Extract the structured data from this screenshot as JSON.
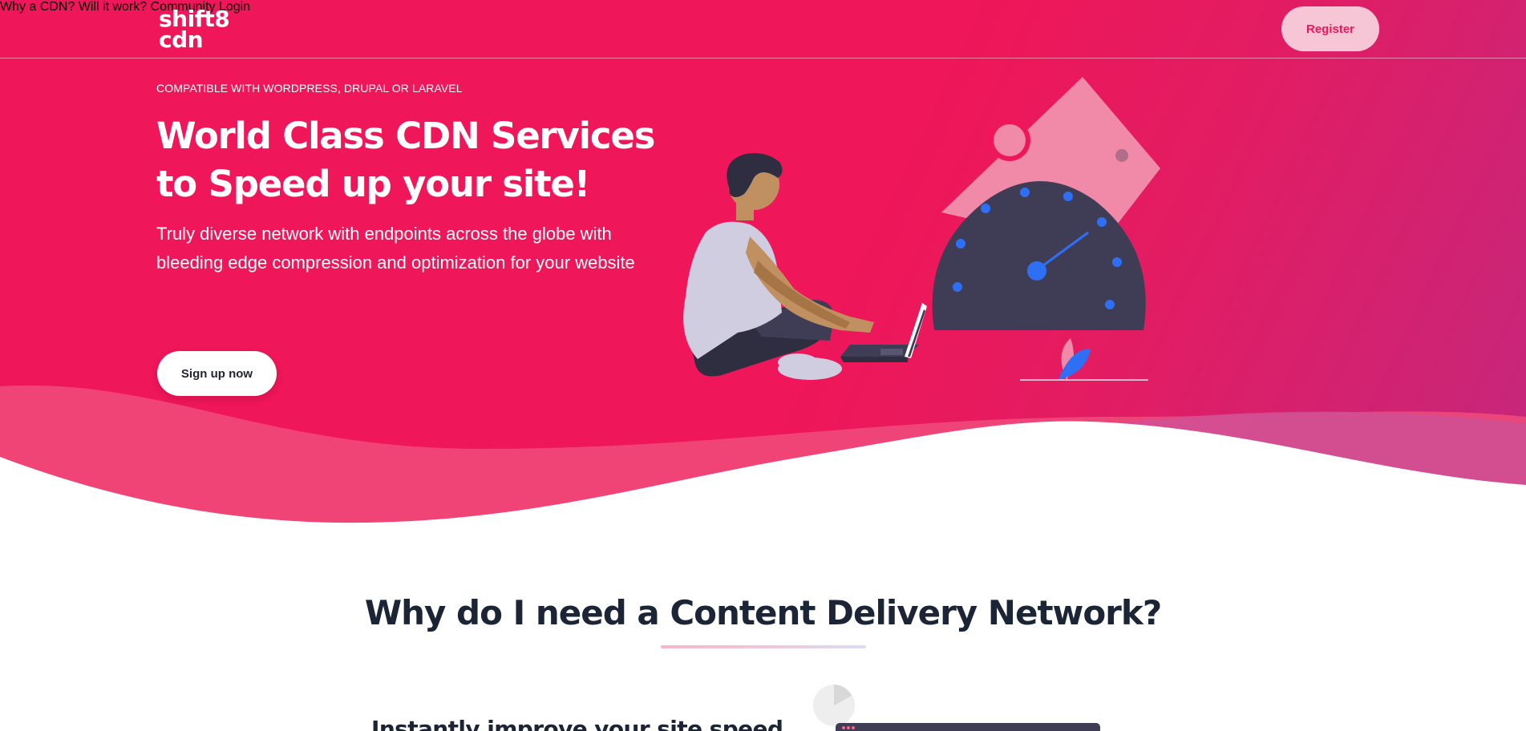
{
  "brand": {
    "logo_line1": "shift8",
    "logo_line2": "cdn"
  },
  "nav": {
    "items": [
      "Why a CDN?",
      "Will it work?",
      "Community",
      "Login"
    ],
    "register_label": "Register"
  },
  "hero": {
    "eyebrow": "COMPATIBLE WITH WORDPRESS, DRUPAL OR LARAVEL",
    "headline": "World Class CDN Services to Speed up your site!",
    "subtext": "Truly diverse network with endpoints across the globe with bleeding edge compression and optimization for your website",
    "cta_label": "Sign up now"
  },
  "section": {
    "title": "Why do I need a Content Delivery Network?",
    "subheading": "Instantly improve your site speed"
  },
  "colors": {
    "hero_pink": "#ef1659",
    "hero_magenta": "#c4277d",
    "register_bg": "#f7c6d6",
    "register_text": "#e8185a",
    "gauge_dark": "#3f3d56",
    "gauge_blue": "#2f6ff5",
    "heading_dark": "#1c2536"
  },
  "icons": {
    "illustration": "person-laptop-speedometer-illustration",
    "gauge": "speedometer-icon"
  }
}
